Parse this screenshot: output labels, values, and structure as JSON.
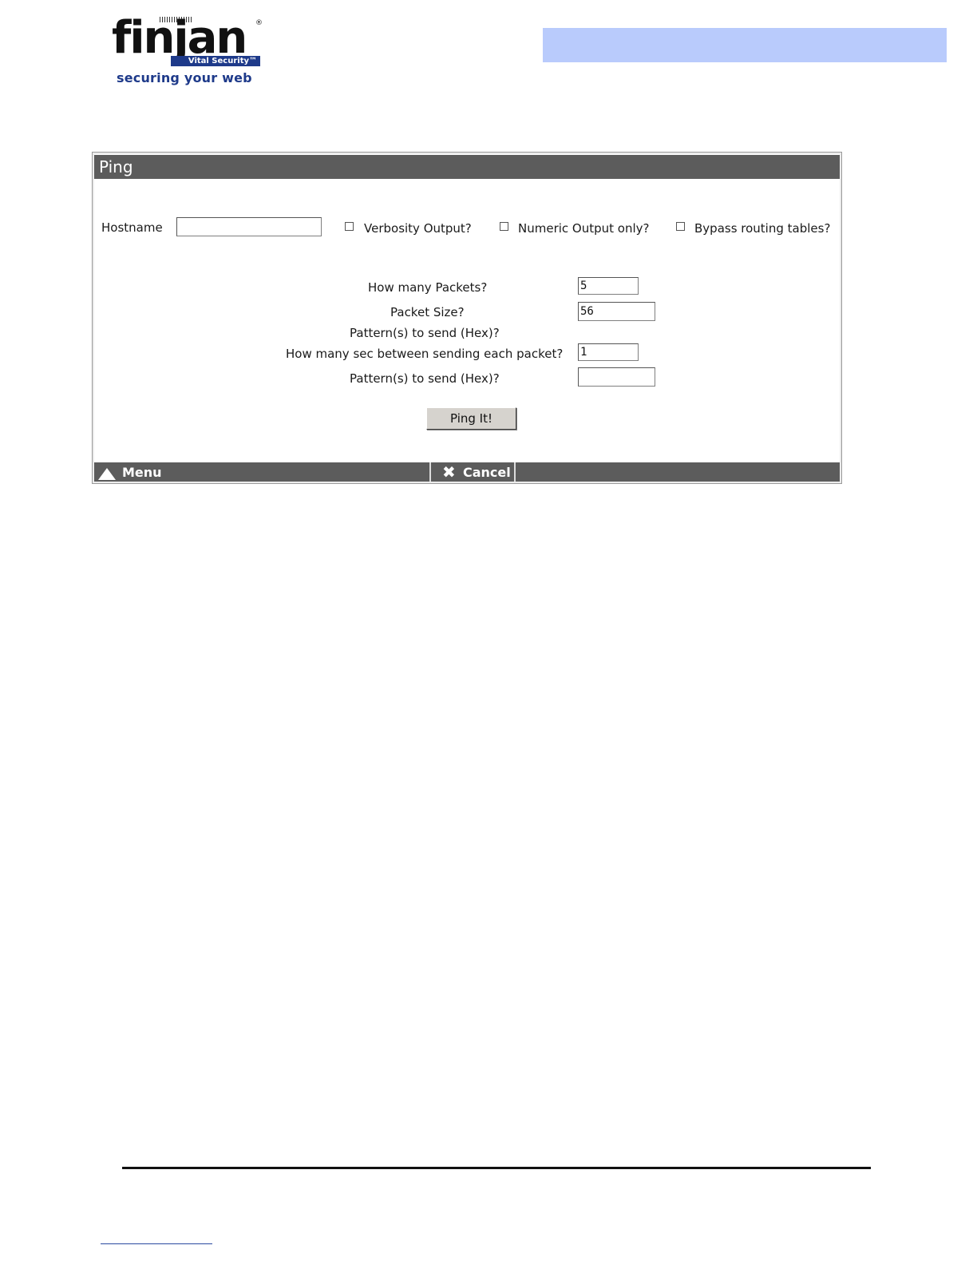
{
  "header": {
    "brand": "finjan",
    "badge": "Vital Security™",
    "tagline": "securing your web",
    "registered_mark": "®"
  },
  "panel": {
    "title": "Ping",
    "hostname_label": "Hostname",
    "hostname_value": "",
    "checkboxes": [
      {
        "label": "Verbosity Output?",
        "checked": false
      },
      {
        "label": "Numeric Output only?",
        "checked": false
      },
      {
        "label": "Bypass routing tables?",
        "checked": false
      }
    ],
    "fields": [
      {
        "label": "How many Packets?",
        "value": "5"
      },
      {
        "label": "Packet Size?",
        "value": "56"
      },
      {
        "label": "Pattern(s) to send (Hex)?"
      },
      {
        "label": "How many sec between sending each packet?",
        "value": "1"
      },
      {
        "label": "Pattern(s) to send (Hex)?",
        "value": ""
      }
    ],
    "submit_label": "Ping It!"
  },
  "footer": {
    "menu_label": "Menu",
    "cancel_label": "Cancel",
    "menu_icon": "up-triangle-icon",
    "cancel_icon": "x-icon"
  },
  "colors": {
    "header_band": "#b9cbfc",
    "title_bar": "#5c5c5c",
    "brand_blue": "#1e3a8a"
  }
}
